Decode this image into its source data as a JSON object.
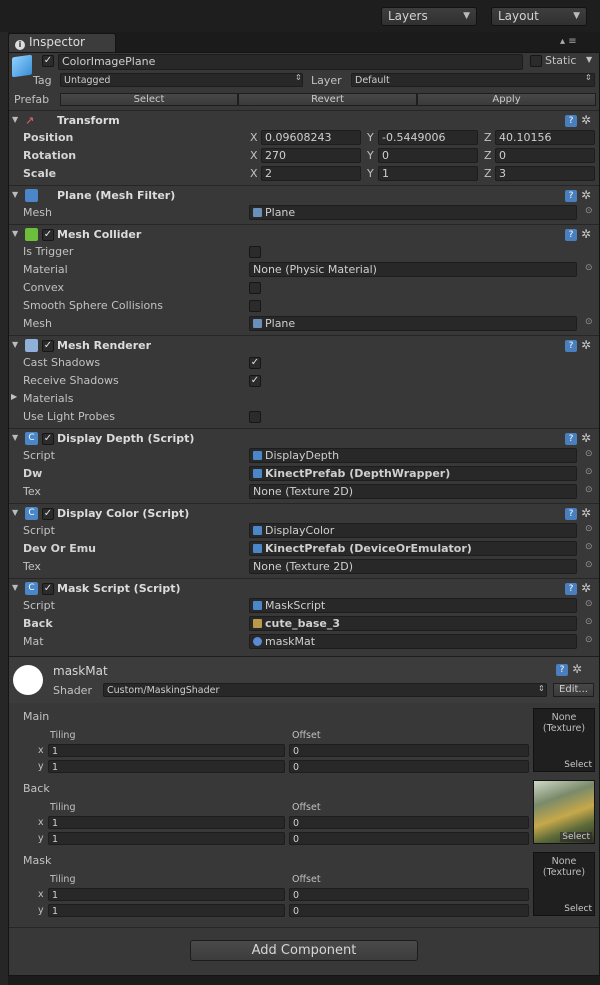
{
  "topbar": {
    "layers_label": "Layers",
    "layout_label": "Layout"
  },
  "tab": {
    "title": "Inspector"
  },
  "object": {
    "name": "ColorImagePlane",
    "static_label": "Static",
    "tag_label": "Tag",
    "tag_value": "Untagged",
    "layer_label": "Layer",
    "layer_value": "Default",
    "prefab_label": "Prefab",
    "select": "Select",
    "revert": "Revert",
    "apply": "Apply"
  },
  "transform": {
    "title": "Transform",
    "position_label": "Position",
    "rotation_label": "Rotation",
    "scale_label": "Scale",
    "axes": [
      "X",
      "Y",
      "Z"
    ],
    "position": [
      "0.09608243",
      "-0.5449006",
      "40.10156"
    ],
    "rotation": [
      "270",
      "0",
      "0"
    ],
    "scale": [
      "2",
      "1",
      "3"
    ]
  },
  "mesh_filter": {
    "title": "Plane (Mesh Filter)",
    "mesh_label": "Mesh",
    "mesh_value": "Plane"
  },
  "mesh_collider": {
    "title": "Mesh Collider",
    "is_trigger": "Is Trigger",
    "material": "Material",
    "material_value": "None (Physic Material)",
    "convex": "Convex",
    "smooth": "Smooth Sphere Collisions",
    "mesh": "Mesh",
    "mesh_value": "Plane"
  },
  "mesh_renderer": {
    "title": "Mesh Renderer",
    "cast_shadows": "Cast Shadows",
    "receive_shadows": "Receive Shadows",
    "materials": "Materials",
    "light_probes": "Use Light Probes"
  },
  "display_depth": {
    "title": "Display Depth (Script)",
    "script_label": "Script",
    "script_value": "DisplayDepth",
    "dw_label": "Dw",
    "dw_value": "KinectPrefab (DepthWrapper)",
    "tex_label": "Tex",
    "tex_value": "None (Texture 2D)"
  },
  "display_color": {
    "title": "Display Color (Script)",
    "script_label": "Script",
    "script_value": "DisplayColor",
    "dev_label": "Dev Or Emu",
    "dev_value": "KinectPrefab (DeviceOrEmulator)",
    "tex_label": "Tex",
    "tex_value": "None (Texture 2D)"
  },
  "mask_script": {
    "title": "Mask Script (Script)",
    "script_label": "Script",
    "script_value": "MaskScript",
    "back_label": "Back",
    "back_value": "cute_base_3",
    "mat_label": "Mat",
    "mat_value": "maskMat"
  },
  "material": {
    "name": "maskMat",
    "shader_label": "Shader",
    "shader_value": "Custom/MaskingShader",
    "edit": "Edit...",
    "slots": [
      {
        "name": "Main",
        "tiling": "Tiling",
        "offset": "Offset",
        "x": "x",
        "y": "y",
        "tx": "1",
        "ty": "1",
        "ox": "0",
        "oy": "0",
        "tex_none": "None",
        "tex_type": "(Texture)",
        "select": "Select"
      },
      {
        "name": "Back",
        "tiling": "Tiling",
        "offset": "Offset",
        "x": "x",
        "y": "y",
        "tx": "1",
        "ty": "1",
        "ox": "0",
        "oy": "0",
        "select": "Select"
      },
      {
        "name": "Mask",
        "tiling": "Tiling",
        "offset": "Offset",
        "x": "x",
        "y": "y",
        "tx": "1",
        "ty": "1",
        "ox": "0",
        "oy": "0",
        "tex_none": "None",
        "tex_type": "(Texture)",
        "select": "Select"
      }
    ]
  },
  "add_component": "Add Component",
  "colors": {
    "panel": "#383838",
    "field": "#282828",
    "script_icon": "#4a86c8"
  }
}
